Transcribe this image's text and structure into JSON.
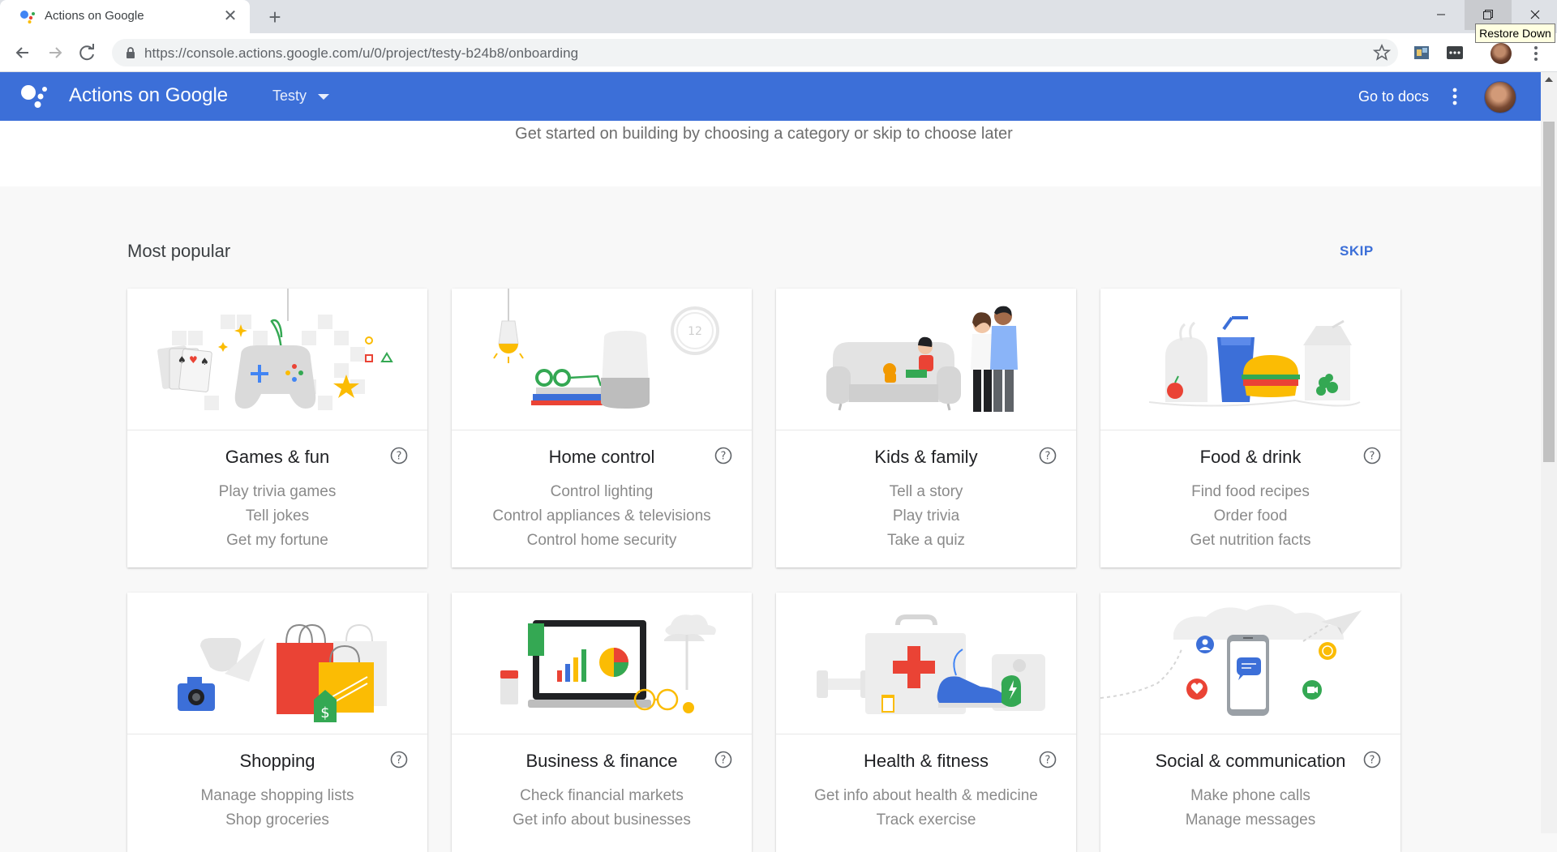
{
  "browser": {
    "tab_title": "Actions on Google",
    "tab_close": "✕",
    "new_tab": "+",
    "url": "https://console.actions.google.com/u/0/project/testy-b24b8/onboarding",
    "tooltip": "Restore Down"
  },
  "header": {
    "app_title": "Actions on Google",
    "project": "Testy",
    "docs_link": "Go to docs",
    "brand_color": "#3c6fd8"
  },
  "page": {
    "subtitle": "Get started on building by choosing a category or skip to choose later",
    "section_title": "Most popular",
    "skip_label": "SKIP"
  },
  "categories": [
    {
      "title": "Games & fun",
      "lines": [
        "Play trivia games",
        "Tell jokes",
        "Get my fortune"
      ],
      "icon": "gamepad-illustration"
    },
    {
      "title": "Home control",
      "lines": [
        "Control lighting",
        "Control appliances & televisions",
        "Control home security"
      ],
      "icon": "smart-speaker-illustration"
    },
    {
      "title": "Kids & family",
      "lines": [
        "Tell a story",
        "Play trivia",
        "Take a quiz"
      ],
      "icon": "family-illustration"
    },
    {
      "title": "Food & drink",
      "lines": [
        "Find food recipes",
        "Order food",
        "Get nutrition facts"
      ],
      "icon": "burger-drink-illustration"
    },
    {
      "title": "Shopping",
      "lines": [
        "Manage shopping lists",
        "Shop groceries"
      ],
      "icon": "shopping-bags-illustration"
    },
    {
      "title": "Business & finance",
      "lines": [
        "Check financial markets",
        "Get info about businesses"
      ],
      "icon": "laptop-chart-illustration"
    },
    {
      "title": "Health & fitness",
      "lines": [
        "Get info about health & medicine",
        "Track exercise"
      ],
      "icon": "first-aid-illustration"
    },
    {
      "title": "Social & communication",
      "lines": [
        "Make phone calls",
        "Manage messages"
      ],
      "icon": "phone-chat-illustration"
    }
  ]
}
